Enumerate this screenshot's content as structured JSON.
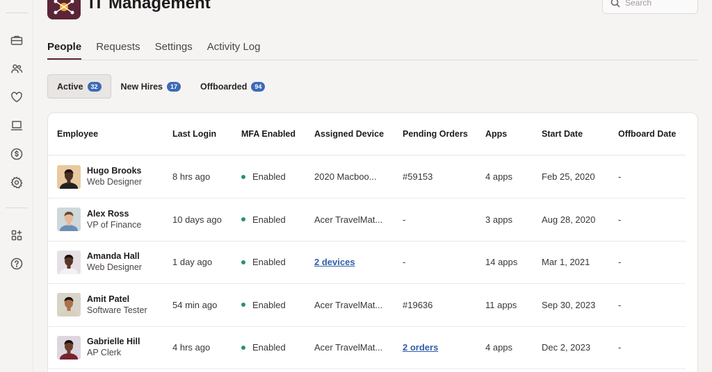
{
  "app": {
    "title": "IT Management"
  },
  "search": {
    "placeholder": "Search"
  },
  "main_tabs": [
    {
      "label": "People",
      "active": true
    },
    {
      "label": "Requests",
      "active": false
    },
    {
      "label": "Settings",
      "active": false
    },
    {
      "label": "Activity Log",
      "active": false
    }
  ],
  "filter_tabs": [
    {
      "label": "Active",
      "count": "32",
      "active": true
    },
    {
      "label": "New Hires",
      "count": "17",
      "active": false
    },
    {
      "label": "Offboarded",
      "count": "94",
      "active": false
    }
  ],
  "sidebar": {
    "items": [
      {
        "icon": "briefcase-icon"
      },
      {
        "icon": "people-icon"
      },
      {
        "icon": "heart-icon"
      },
      {
        "icon": "laptop-icon"
      },
      {
        "icon": "dollar-icon"
      },
      {
        "icon": "gear-icon"
      },
      {
        "icon": "add-apps-icon"
      },
      {
        "icon": "help-icon"
      }
    ]
  },
  "table": {
    "columns": [
      "Employee",
      "Last Login",
      "MFA Enabled",
      "Assigned Device",
      "Pending Orders",
      "Apps",
      "Start Date",
      "Offboard Date"
    ],
    "rows": [
      {
        "name": "Hugo Brooks",
        "role": "Web Designer",
        "last_login": "8 hrs ago",
        "mfa": "Enabled",
        "device": "2020 Macboo...",
        "device_link": false,
        "orders": "#59153",
        "orders_link": false,
        "apps": "4 apps",
        "start": "Feb 25, 2020",
        "offboard": "-"
      },
      {
        "name": "Alex Ross",
        "role": "VP of Finance",
        "last_login": "10 days ago",
        "mfa": "Enabled",
        "device": "Acer TravelMat...",
        "device_link": false,
        "orders": "-",
        "orders_link": false,
        "apps": "3 apps",
        "start": "Aug 28, 2020",
        "offboard": "-"
      },
      {
        "name": "Amanda Hall",
        "role": "Web Designer",
        "last_login": "1 day ago",
        "mfa": "Enabled",
        "device": "2 devices",
        "device_link": true,
        "orders": "-",
        "orders_link": false,
        "apps": "14 apps",
        "start": "Mar 1, 2021",
        "offboard": "-"
      },
      {
        "name": "Amit Patel",
        "role": "Software Tester",
        "last_login": "54 min ago",
        "mfa": "Enabled",
        "device": "Acer TravelMat...",
        "device_link": false,
        "orders": "#19636",
        "orders_link": false,
        "apps": "11 apps",
        "start": "Sep 30, 2023",
        "offboard": "-"
      },
      {
        "name": "Gabrielle Hill",
        "role": "AP Clerk",
        "last_login": "4 hrs ago",
        "mfa": "Enabled",
        "device": "Acer TravelMat...",
        "device_link": false,
        "orders": "2 orders",
        "orders_link": true,
        "apps": "4 apps",
        "start": "Dec 2, 2023",
        "offboard": "-"
      }
    ]
  },
  "colors": {
    "brand": "#5a2536",
    "accent_badge": "#3c6ab5",
    "mfa_dot": "#2a8f7a",
    "link": "#2f5ea8"
  }
}
